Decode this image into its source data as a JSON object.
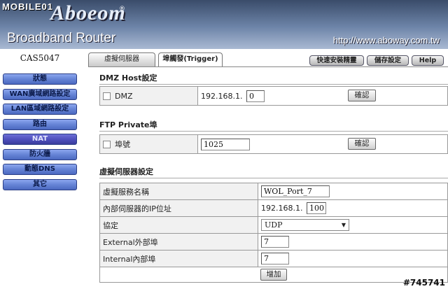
{
  "header": {
    "watermark_brand": "MOBILE01",
    "logo": "Aboeom",
    "reg_mark": "®",
    "product": "Broadband Router",
    "url": "http://www.aboway.com.tw"
  },
  "sidebar": {
    "model": "CAS5047",
    "items": [
      {
        "label": "狀態"
      },
      {
        "label": "WAN廣域網路設定"
      },
      {
        "label": "LAN區域網路設定"
      },
      {
        "label": "路由"
      },
      {
        "label": "NAT"
      },
      {
        "label": "防火牆"
      },
      {
        "label": "動態DNS"
      },
      {
        "label": "其它"
      }
    ]
  },
  "tabs": [
    {
      "label": "虛擬伺服器"
    },
    {
      "label": "埠觸發(Trigger)"
    }
  ],
  "top_buttons": {
    "quick_setup": "快速安裝精靈",
    "save_settings": "儲存設定",
    "help": "Help"
  },
  "dmz": {
    "section_title": "DMZ Host設定",
    "checkbox_label": "DMZ",
    "ip_prefix": "192.168.1.",
    "ip_value": "0",
    "confirm_label": "確認"
  },
  "ftp": {
    "section_title": "FTP Private埠",
    "checkbox_label": "埠號",
    "port_value": "1025",
    "confirm_label": "確認"
  },
  "virtual_server": {
    "section_title": "虛擬伺服器設定",
    "rows": {
      "name_label": "虛擬服務名稱",
      "name_value": "WOL_Port_7",
      "ip_label": "內部伺服器的IP位址",
      "ip_prefix": "192.168.1.",
      "ip_value": "100",
      "protocol_label": "協定",
      "protocol_value": "UDP",
      "external_label": "External外部埠",
      "external_value": "7",
      "internal_label": "Internal內部埠",
      "internal_value": "7"
    },
    "add_label": "增加"
  },
  "watermark": "#745741"
}
